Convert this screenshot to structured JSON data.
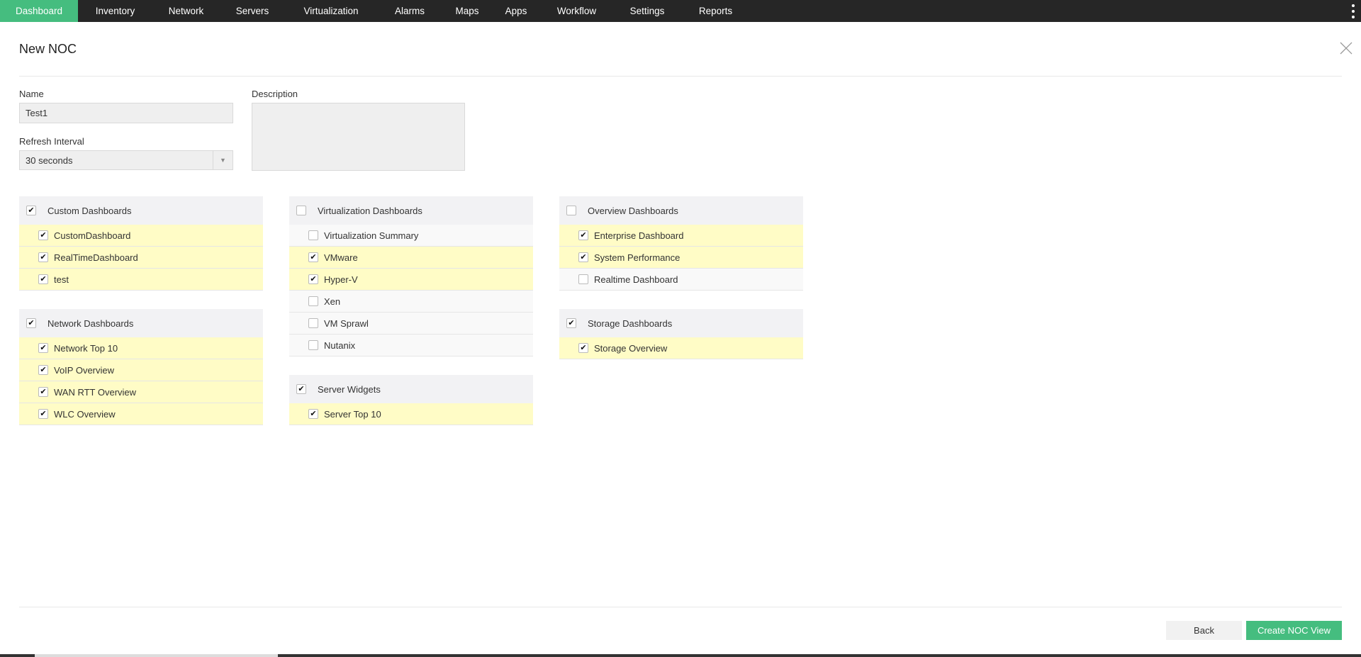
{
  "nav": {
    "tabs": [
      "Dashboard",
      "Inventory",
      "Network",
      "Servers",
      "Virtualization",
      "Alarms",
      "Maps",
      "Apps",
      "Workflow",
      "Settings",
      "Reports"
    ],
    "active": "Dashboard"
  },
  "page": {
    "title": "New NOC"
  },
  "form": {
    "name_label": "Name",
    "name_value": "Test1",
    "refresh_label": "Refresh Interval",
    "refresh_value": "30 seconds",
    "description_label": "Description",
    "description_value": ""
  },
  "groups": [
    {
      "title": "Custom Dashboards",
      "checked": true,
      "items": [
        {
          "label": "CustomDashboard",
          "checked": true
        },
        {
          "label": "RealTimeDashboard",
          "checked": true
        },
        {
          "label": "test",
          "checked": true
        }
      ]
    },
    {
      "title": "Network Dashboards",
      "checked": true,
      "items": [
        {
          "label": "Network Top 10",
          "checked": true
        },
        {
          "label": "VoIP Overview",
          "checked": true
        },
        {
          "label": "WAN RTT Overview",
          "checked": true
        },
        {
          "label": "WLC Overview",
          "checked": true
        }
      ]
    },
    {
      "title": "Virtualization Dashboards",
      "checked": false,
      "items": [
        {
          "label": "Virtualization Summary",
          "checked": false
        },
        {
          "label": "VMware",
          "checked": true
        },
        {
          "label": "Hyper-V",
          "checked": true
        },
        {
          "label": "Xen",
          "checked": false
        },
        {
          "label": "VM Sprawl",
          "checked": false
        },
        {
          "label": "Nutanix",
          "checked": false
        }
      ]
    },
    {
      "title": "Server Widgets",
      "checked": true,
      "items": [
        {
          "label": "Server Top 10",
          "checked": true
        }
      ]
    },
    {
      "title": "Overview Dashboards",
      "checked": false,
      "items": [
        {
          "label": "Enterprise Dashboard",
          "checked": true
        },
        {
          "label": "System Performance",
          "checked": true
        },
        {
          "label": "Realtime Dashboard",
          "checked": false
        }
      ]
    },
    {
      "title": "Storage Dashboards",
      "checked": true,
      "items": [
        {
          "label": "Storage Overview",
          "checked": true
        }
      ]
    }
  ],
  "footer": {
    "back_label": "Back",
    "create_label": "Create NOC View"
  },
  "colors": {
    "accent": "#45bd7f",
    "nav_bg": "#262626",
    "checked_row": "#fffcc6"
  }
}
